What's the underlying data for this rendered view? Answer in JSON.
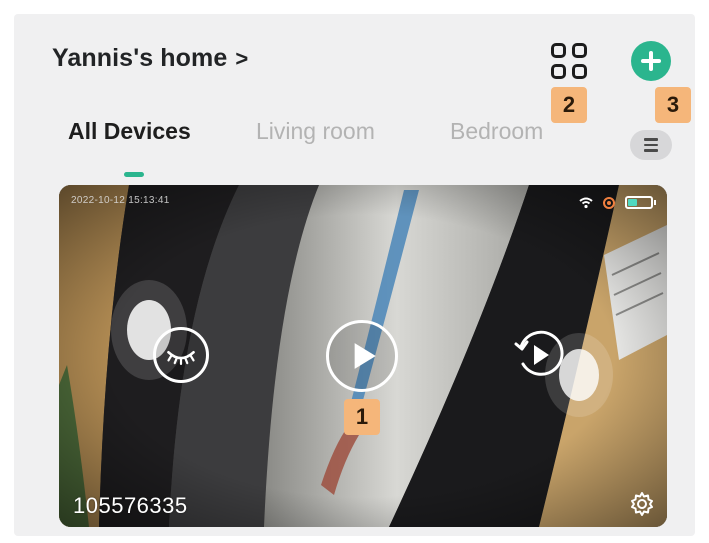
{
  "header": {
    "home_name": "Yannis's home",
    "home_chevron": ">"
  },
  "tabs": [
    {
      "label": "All Devices",
      "active": true
    },
    {
      "label": "Living room",
      "active": false
    },
    {
      "label": "Bedroom",
      "active": false
    }
  ],
  "badges": {
    "play": "1",
    "grid": "2",
    "add": "3"
  },
  "camera": {
    "timestamp": "2022-10-12 15:13:41",
    "device_id": "105576335",
    "status_icons": [
      "wifi-icon",
      "recording-icon",
      "battery-icon"
    ],
    "controls": [
      "privacy-mode-icon",
      "play-icon",
      "playback-icon"
    ],
    "settings_icon": "gear-icon"
  },
  "colors": {
    "accent": "#2bb58e",
    "badge": "#f5b67a",
    "background": "#f0f0f1"
  }
}
